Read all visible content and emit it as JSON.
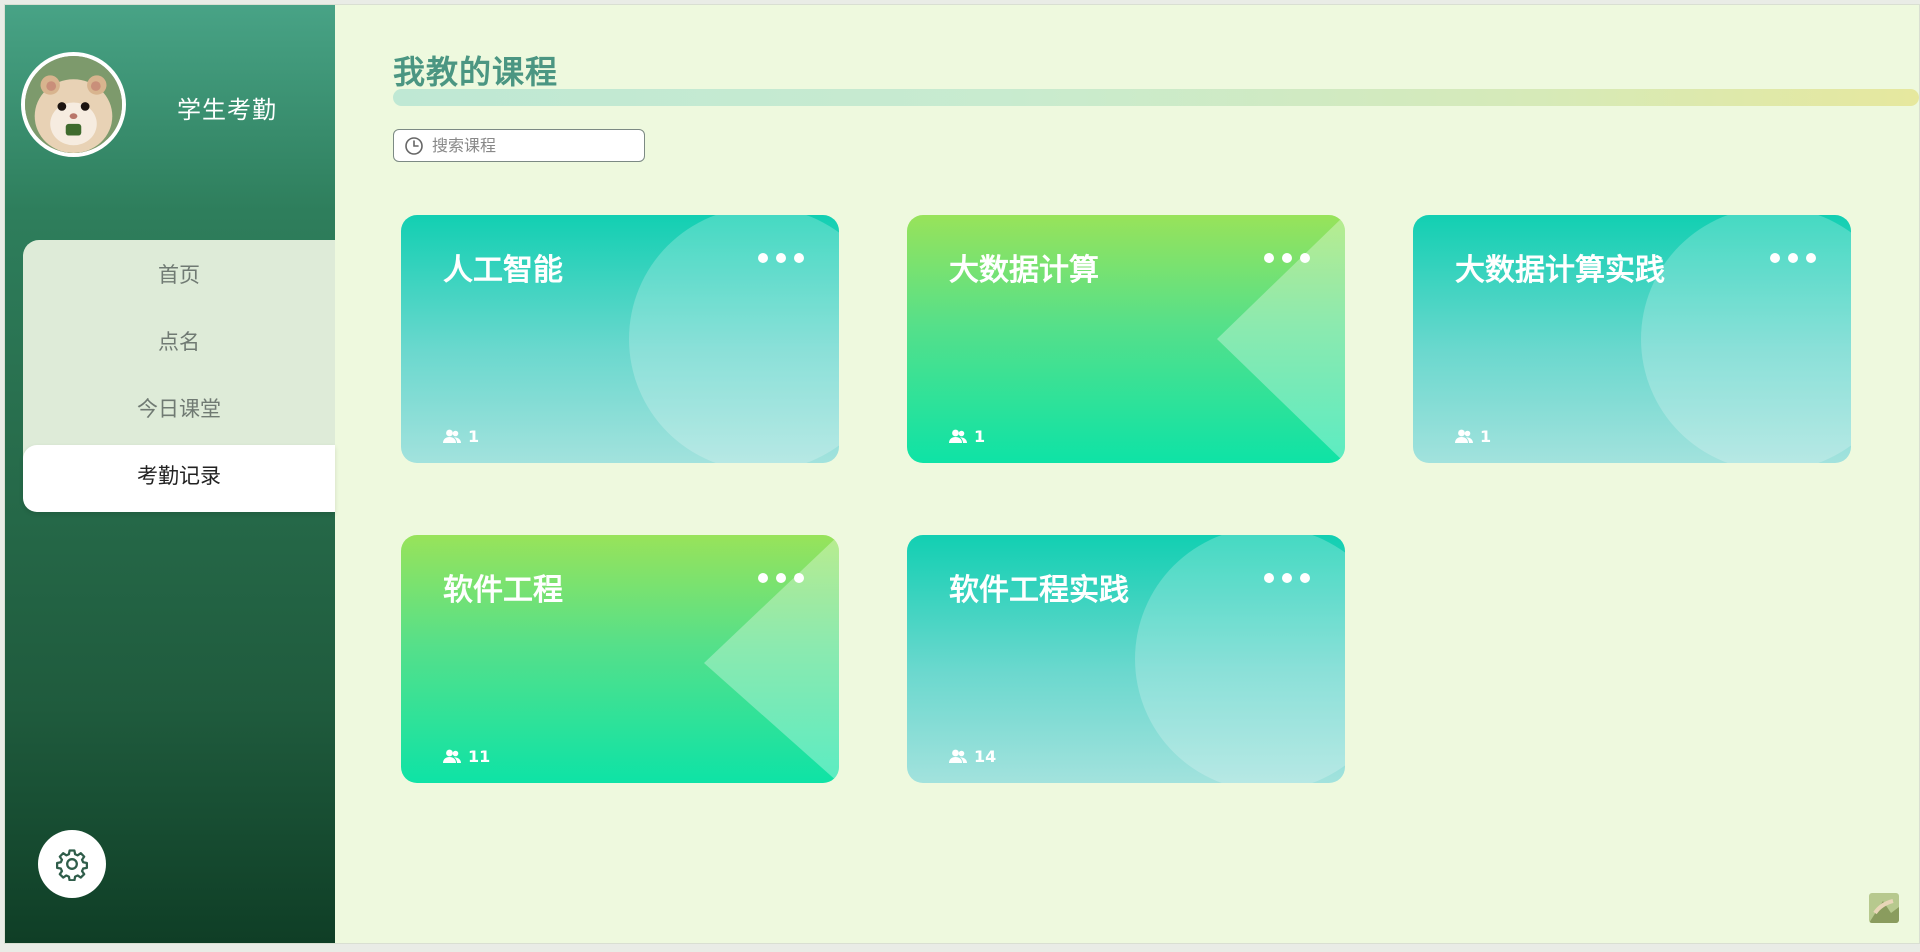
{
  "sidebar": {
    "app_name": "学生考勤",
    "avatar_icon": "hamster-avatar",
    "nav": [
      {
        "label": "首页",
        "active": false
      },
      {
        "label": "点名",
        "active": false
      },
      {
        "label": "今日课堂",
        "active": false
      },
      {
        "label": "考勤记录",
        "active": true
      }
    ],
    "settings_icon": "gear-icon"
  },
  "main": {
    "title": "我教的课程",
    "search_placeholder": "搜索课程",
    "courses": [
      {
        "name": "人工智能",
        "count": "1",
        "style": "teal"
      },
      {
        "name": "大数据计算",
        "count": "1",
        "style": "green"
      },
      {
        "name": "大数据计算实践",
        "count": "1",
        "style": "teal"
      },
      {
        "name": "软件工程",
        "count": "11",
        "style": "green"
      },
      {
        "name": "软件工程实践",
        "count": "14",
        "style": "teal"
      }
    ]
  },
  "colors": {
    "sidebar_top": "#48a386",
    "sidebar_bottom": "#0f3e26",
    "page_bg": "#eef9de",
    "card_teal": "#12cfb2",
    "card_green": "#98e35a",
    "title_text": "#4b9682"
  }
}
